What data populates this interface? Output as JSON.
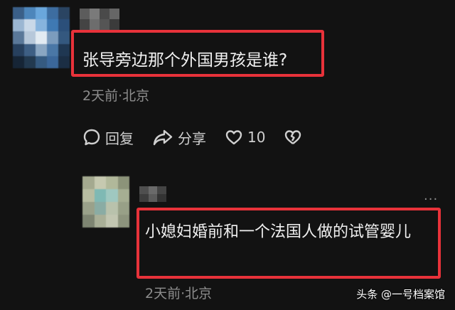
{
  "comments": [
    {
      "text": "张导旁边那个外国男孩是谁?",
      "meta": "2天前·北京",
      "actions": {
        "reply_label": "回复",
        "share_label": "分享",
        "like_count": "10"
      }
    },
    {
      "text": "小媳妇婚前和一个法国人做的试管婴儿",
      "meta": "2天前·北京",
      "more": "···"
    }
  ],
  "watermark": "头条 @一号档案馆",
  "colors": {
    "background": "#121212",
    "highlight_border": "#e8323a",
    "text": "#f0f0f0",
    "meta": "#8d8d8d"
  },
  "icons": [
    "comment-bubble-icon",
    "share-arrow-icon",
    "heart-icon",
    "broken-heart-icon",
    "more-icon"
  ]
}
